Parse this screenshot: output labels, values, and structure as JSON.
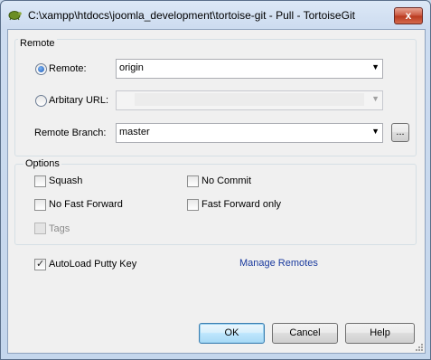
{
  "window": {
    "title": "C:\\xampp\\htdocs\\joomla_development\\tortoise-git - Pull - TortoiseGit",
    "close_glyph": "x"
  },
  "remote_group": {
    "label": "Remote",
    "remote_radio_label": "Remote:",
    "remote_value": "origin",
    "arbitrary_url_label": "Arbitary URL:",
    "arbitrary_url_value": "",
    "remote_branch_label": "Remote Branch:",
    "remote_branch_value": "master",
    "browse_label": "..."
  },
  "options_group": {
    "label": "Options",
    "squash": {
      "label": "Squash",
      "checked": false
    },
    "no_commit": {
      "label": "No Commit",
      "checked": false
    },
    "no_fast_forward": {
      "label": "No Fast Forward",
      "checked": false
    },
    "fast_forward_only": {
      "label": "Fast Forward only",
      "checked": false
    },
    "tags": {
      "label": "Tags",
      "checked": false,
      "disabled": true
    }
  },
  "autoload_putty_key": {
    "label": "AutoLoad Putty Key",
    "checked": true,
    "checkmark": "✓"
  },
  "manage_remotes_link": "Manage Remotes",
  "buttons": {
    "ok": "OK",
    "cancel": "Cancel",
    "help": "Help"
  },
  "colors": {
    "link": "#1a3a9e",
    "accent": "#1e5bb8",
    "close": "#c9533b"
  }
}
